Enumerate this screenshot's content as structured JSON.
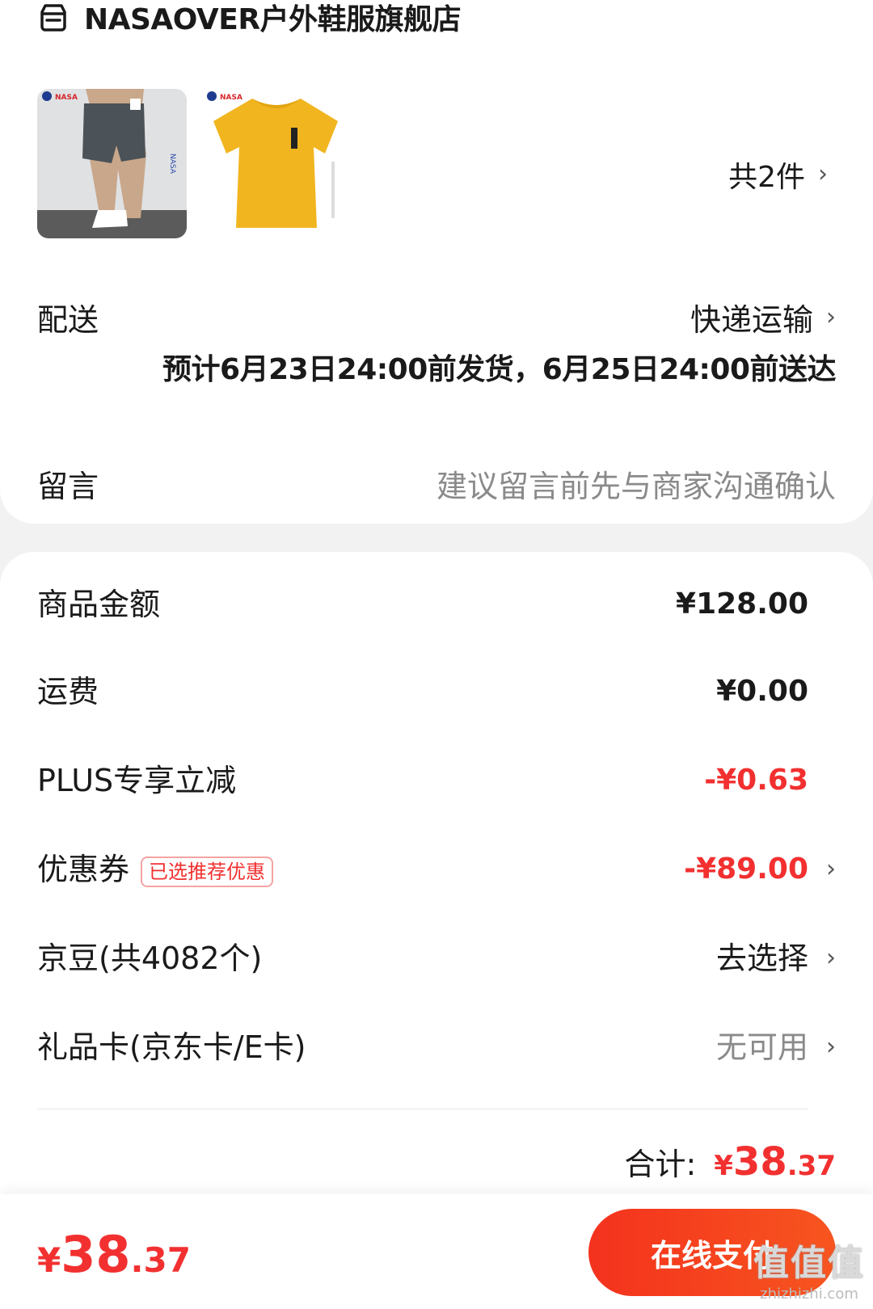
{
  "store": {
    "name": "NASAOVER户外鞋服旗舰店",
    "icon": "store-icon"
  },
  "items": {
    "count_label": "共2件",
    "thumbnails": [
      {
        "name": "product-shorts",
        "brand": "NASA",
        "color": "#4a5056"
      },
      {
        "name": "product-tshirt",
        "brand": "NASA",
        "color": "#f1b51f"
      }
    ]
  },
  "delivery": {
    "label": "配送",
    "method": "快递运输",
    "eta": "预计6月23日24:00前发货，6月25日24:00前送达"
  },
  "note": {
    "label": "留言",
    "placeholder": "建议留言前先与商家沟通确认"
  },
  "fees": {
    "goods_label": "商品金额",
    "goods_value": "¥128.00",
    "shipping_label": "运费",
    "shipping_value": "¥0.00",
    "plus_label": "PLUS专享立减",
    "plus_value": "-¥0.63",
    "coupon_label": "优惠券",
    "coupon_badge": "已选推荐优惠",
    "coupon_value": "-¥89.00",
    "beans_label": "京豆(共4082个)",
    "beans_value": "去选择",
    "giftcard_label": "礼品卡(京东卡/E卡)",
    "giftcard_value": "无可用"
  },
  "total": {
    "label": "合计:",
    "yen": "¥",
    "int": "38",
    "dec": ".37"
  },
  "bottom": {
    "yen": "¥",
    "int": "38",
    "dec": ".37",
    "pay_button": "在线支付"
  },
  "watermark": {
    "big": "值值值",
    "small": "zhizhizhi.com"
  },
  "colors": {
    "accent": "#f23030",
    "button": "#f4321e"
  }
}
